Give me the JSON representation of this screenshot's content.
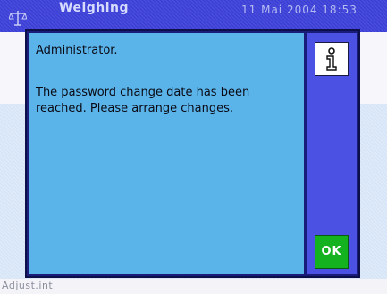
{
  "app": {
    "title": "Weighing",
    "date_time": "11 Mai 2004  18:53",
    "footer_label": "Adjust.int"
  },
  "dialog": {
    "user": "Administrator.",
    "message": "The password change date has been reached. Please arrange changes.",
    "info_icon": "info-icon",
    "ok_label": "OK"
  },
  "colors": {
    "dialog_body": "#5ab4ea",
    "dialog_side": "#4b51e3",
    "ok_button": "#14b21f",
    "titlebar": "#3b3fd6"
  }
}
